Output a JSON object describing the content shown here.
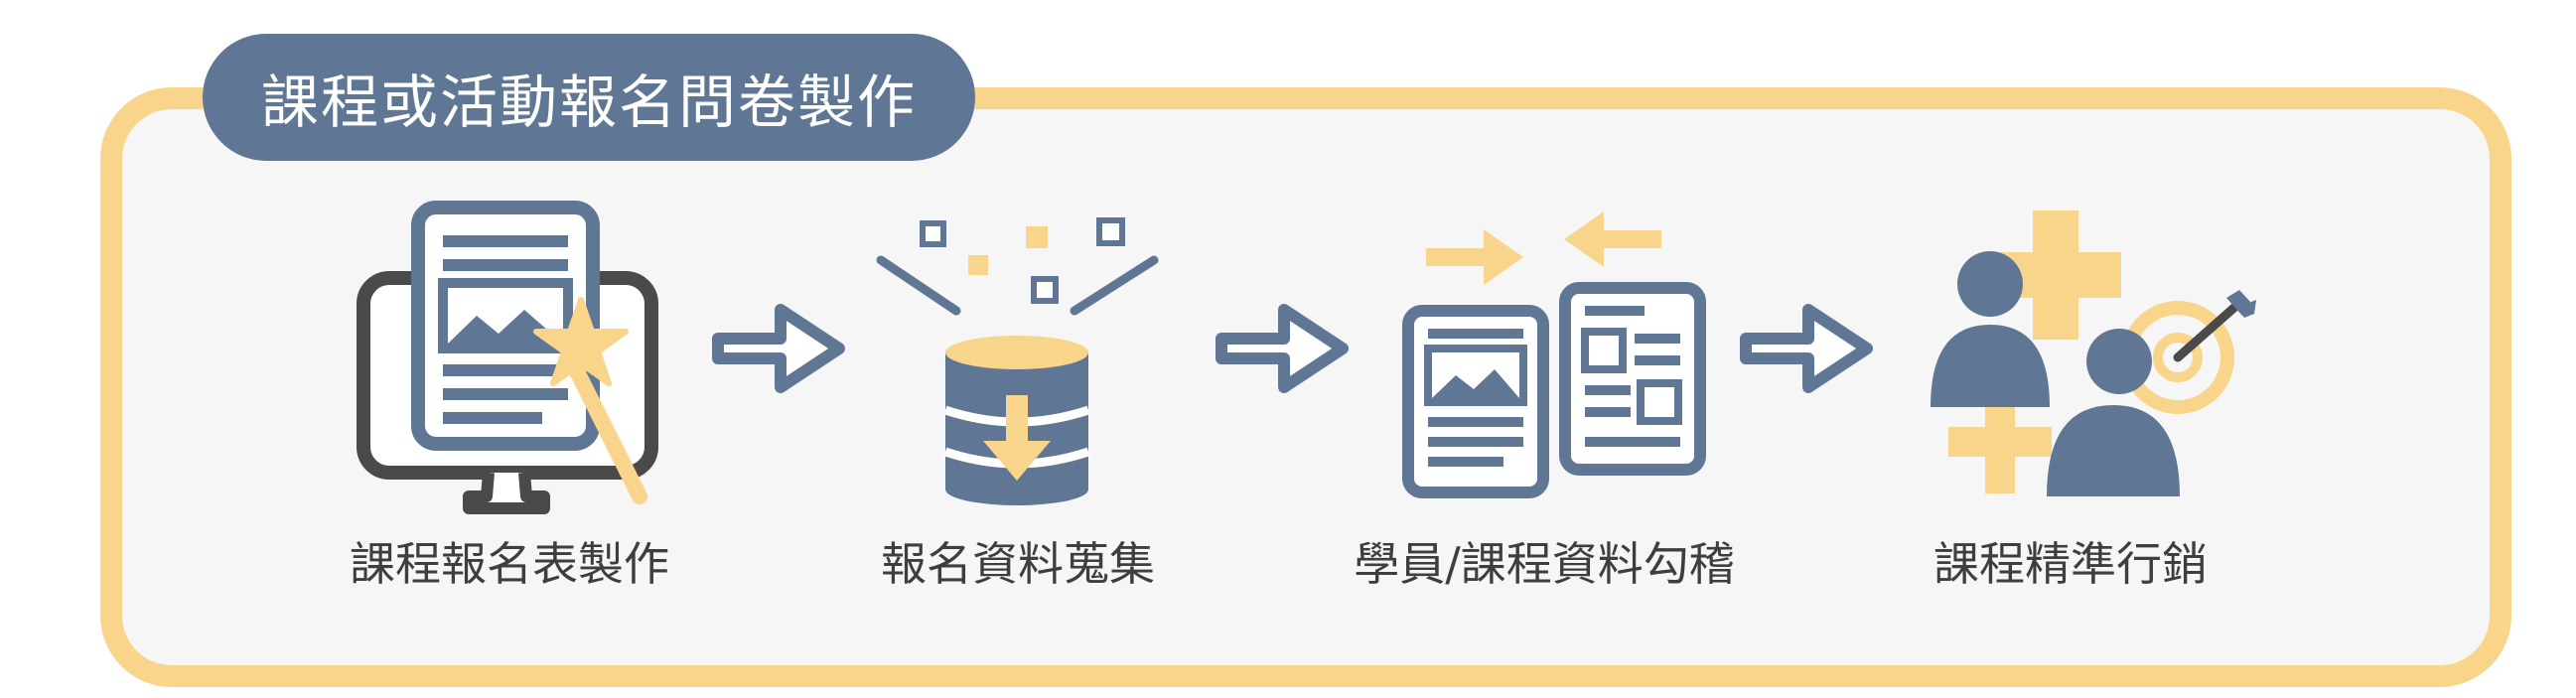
{
  "title": "課程或活動報名問卷製作",
  "steps": [
    {
      "label": "課程報名表製作",
      "icon": "form-editor-icon"
    },
    {
      "label": "報名資料蒐集",
      "icon": "database-collect-icon"
    },
    {
      "label": "學員/課程資料勾稽",
      "icon": "document-compare-icon"
    },
    {
      "label": "課程精準行銷",
      "icon": "target-marketing-icon"
    }
  ],
  "colors": {
    "navy": "#5F7794",
    "yellow": "#F8D58A",
    "dark": "#4A4A4A",
    "panel": "#F6F6F6"
  }
}
